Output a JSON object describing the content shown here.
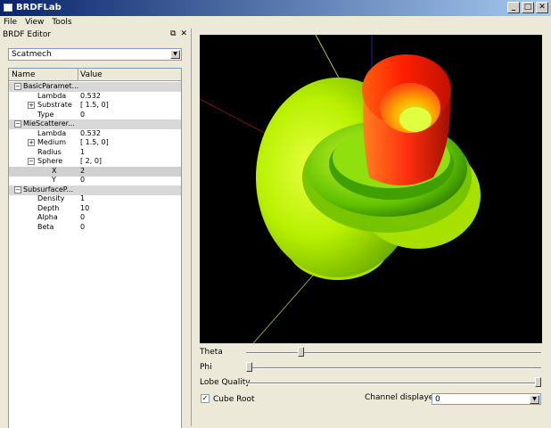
{
  "window": {
    "title": "BRDFLab",
    "minimize": "_",
    "maximize": "□",
    "close": "✕"
  },
  "menu": [
    "File",
    "View",
    "Tools"
  ],
  "dock": {
    "title": "BRDF Editor",
    "float_btn": "⧉",
    "close_btn": "✕",
    "model_select": "Scatmech",
    "tree": {
      "col_name": "Name",
      "col_value": "Value",
      "rows": [
        {
          "label": "BasicParamet...",
          "value": "",
          "type": "group",
          "toggle": "−"
        },
        {
          "label": "Lambda",
          "value": "0.532",
          "type": "item"
        },
        {
          "label": "Substrate",
          "value": "[ 1.5, 0]",
          "type": "item",
          "toggle": "+"
        },
        {
          "label": "Type",
          "value": "0",
          "type": "item"
        },
        {
          "label": "MieScatterer...",
          "value": "",
          "type": "group",
          "toggle": "−"
        },
        {
          "label": "Lambda",
          "value": "0.532",
          "type": "item"
        },
        {
          "label": "Medium",
          "value": "[ 1.5, 0]",
          "type": "item",
          "toggle": "+"
        },
        {
          "label": "Radius",
          "value": "1",
          "type": "item"
        },
        {
          "label": "Sphere",
          "value": "[ 2, 0]",
          "type": "item",
          "toggle": "−"
        },
        {
          "label": "X",
          "value": "2",
          "type": "sub",
          "selected": true
        },
        {
          "label": "Y",
          "value": "0",
          "type": "sub"
        },
        {
          "label": "SubsurfaceP...",
          "value": "",
          "type": "group",
          "toggle": "−"
        },
        {
          "label": "Density",
          "value": "1",
          "type": "item"
        },
        {
          "label": "Depth",
          "value": "10",
          "type": "item"
        },
        {
          "label": "Alpha",
          "value": "0",
          "type": "item"
        },
        {
          "label": "Beta",
          "value": "0",
          "type": "item"
        }
      ]
    }
  },
  "controls": {
    "theta_label": "Theta",
    "theta_value": 0.18,
    "phi_label": "Phi",
    "phi_value": 0.0,
    "lobe_label": "Lobe Quality",
    "lobe_value": 1.0,
    "cube_root_label": "Cube Root",
    "cube_root_checked": true,
    "channel_label": "Channel displayed:",
    "channel_value": "0"
  },
  "icons": {
    "check": "✓",
    "dropdown": "▼"
  }
}
